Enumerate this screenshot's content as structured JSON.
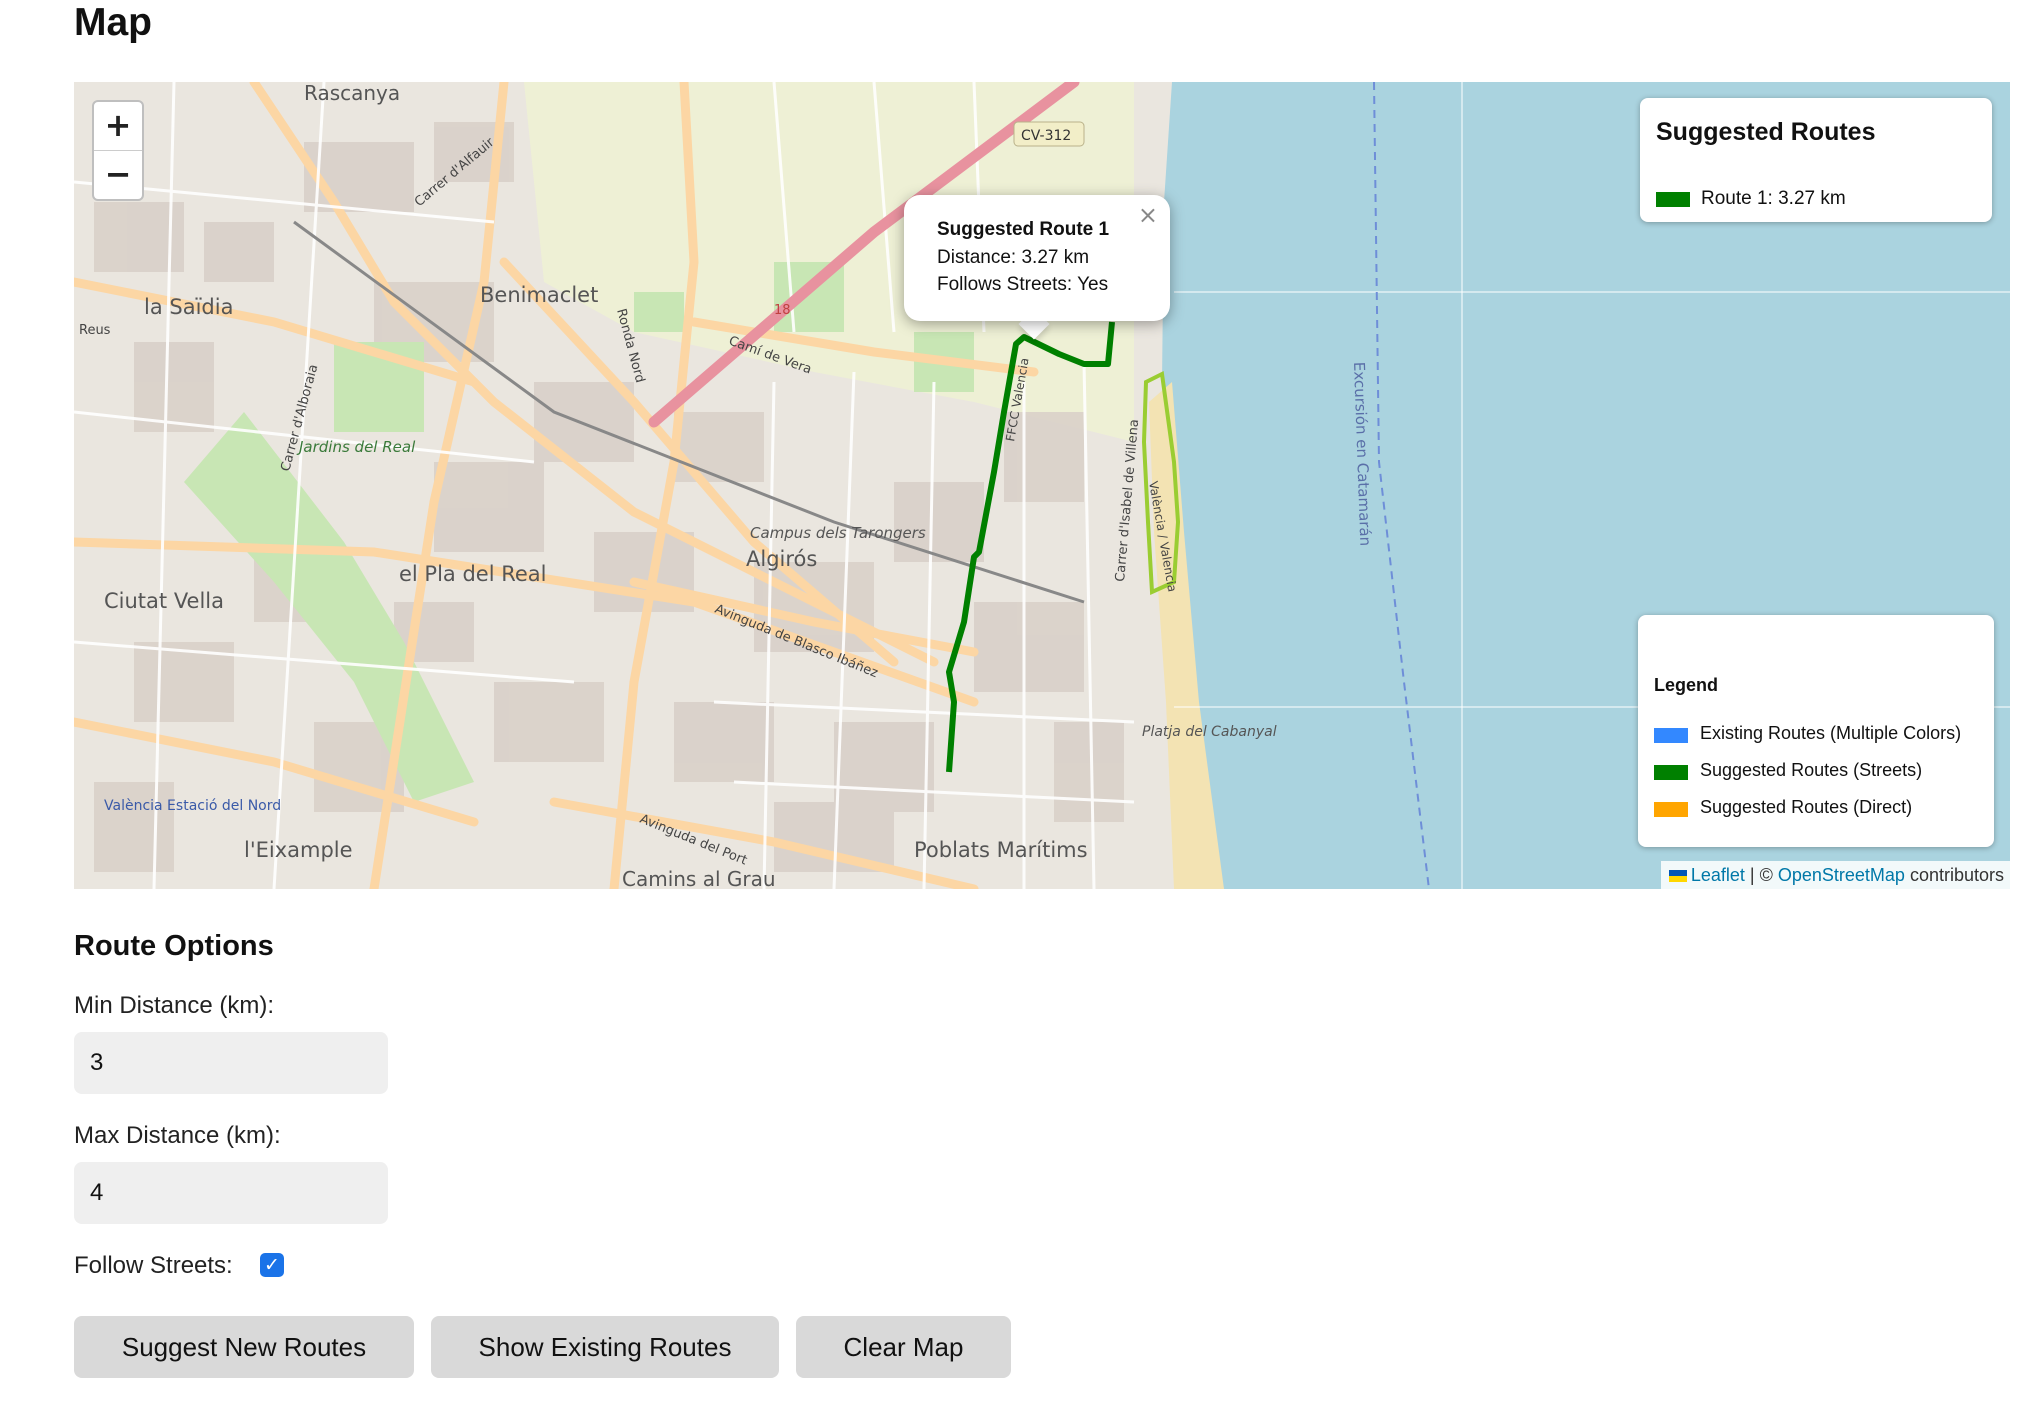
{
  "page": {
    "title": "Map"
  },
  "map": {
    "zoom_in": "+",
    "zoom_out": "−",
    "place_labels": [
      "Rascanya",
      "Benimaclet",
      "la Saïdia",
      "el Pla del Real",
      "Ciutat Vella",
      "Algirós",
      "Campus dels Tarongers",
      "Jardins del Real",
      "València Estació del Nord",
      "l'Eixample",
      "Poblats Marítims",
      "Camins al Grau",
      "Platja del Cabanyal",
      "Excursión en Catamarán",
      "CV-312",
      "Carrer d'Alfauir",
      "Ronda Nord",
      "Camí de Vera",
      "Avinguda de Blasco Ibáñez",
      "Avinguda del Port",
      "Carrer d'Isabel de Villena",
      "Carrer d'Alboraia",
      "Reus",
      "18",
      "FFCC Valencia",
      "València / Valencia"
    ],
    "popup": {
      "close": "×",
      "title": "Suggested Route 1",
      "distance": "Distance: 3.27 km",
      "follows": "Follows Streets: Yes"
    },
    "suggested_panel": {
      "title": "Suggested Routes",
      "routes": [
        {
          "label": "Route 1: 3.27 km",
          "color": "#008000"
        }
      ]
    },
    "legend": {
      "title": "Legend",
      "items": [
        {
          "label": "Existing Routes (Multiple Colors)",
          "color": "#3388ff"
        },
        {
          "label": "Suggested Routes (Streets)",
          "color": "#008000"
        },
        {
          "label": "Suggested Routes (Direct)",
          "color": "#ffa500"
        }
      ]
    },
    "attribution": {
      "leaflet": "Leaflet",
      "separator": " | © ",
      "osm": "OpenStreetMap",
      "suffix": " contributors"
    },
    "colors": {
      "sea": "#aad3df",
      "route": "#008000",
      "highlight": "#9acd32",
      "motorway": "#e8929f"
    }
  },
  "options": {
    "title": "Route Options",
    "min_label": "Min Distance (km):",
    "min_value": "3",
    "max_label": "Max Distance (km):",
    "max_value": "4",
    "follow_label": "Follow Streets:",
    "follow_checked": true,
    "buttons": {
      "suggest": "Suggest New Routes",
      "show": "Show Existing Routes",
      "clear": "Clear Map"
    }
  }
}
